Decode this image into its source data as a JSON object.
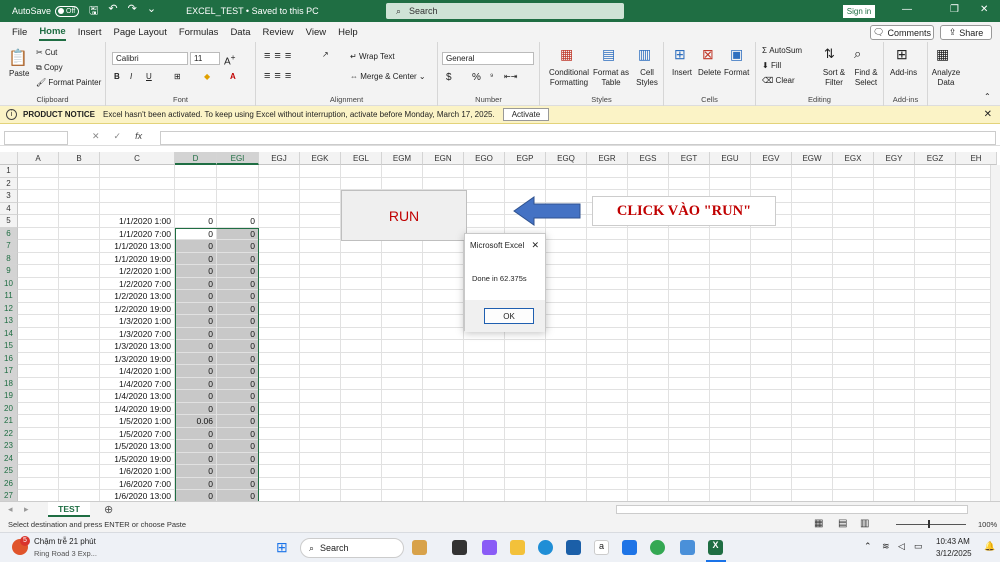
{
  "titlebar": {
    "autosave_label": "AutoSave",
    "autosave_state": "Off",
    "file_title": "EXCEL_TEST • Saved to this PC",
    "search_placeholder": "Search",
    "signin_label": "Sign in"
  },
  "tabs": [
    "File",
    "Home",
    "Insert",
    "Page Layout",
    "Formulas",
    "Data",
    "Review",
    "View",
    "Help"
  ],
  "tab_actions": {
    "comments": "Comments",
    "share": "Share"
  },
  "ribbon": {
    "clipboard": {
      "paste": "Paste",
      "cut": "Cut",
      "copy": "Copy",
      "format_painter": "Format Painter",
      "label": "Clipboard"
    },
    "font": {
      "name": "Calibri",
      "size": "11",
      "bold": "B",
      "italic": "I",
      "underline": "U",
      "label": "Font"
    },
    "alignment": {
      "wrap": "Wrap Text",
      "merge": "Merge & Center",
      "label": "Alignment"
    },
    "number": {
      "format": "General",
      "currency": "$",
      "percent": "%",
      "label": "Number"
    },
    "styles": {
      "conditional": "Conditional Formatting",
      "format_table": "Format as Table",
      "cell_styles": "Cell Styles",
      "label": "Styles"
    },
    "cells": {
      "insert": "Insert",
      "delete": "Delete",
      "format": "Format",
      "label": "Cells"
    },
    "editing": {
      "autosum": "AutoSum",
      "fill": "Fill",
      "clear": "Clear",
      "sort": "Sort & Filter",
      "find": "Find & Select",
      "label": "Editing"
    },
    "addins": {
      "addins": "Add-ins",
      "label": "Add-ins"
    },
    "analyze": {
      "label": "Analyze Data"
    }
  },
  "notice": {
    "title": "PRODUCT NOTICE",
    "message": "Excel hasn't been activated. To keep using Excel without interruption, activate before Monday, March 17, 2025.",
    "button": "Activate"
  },
  "formula_bar": {
    "fx": "fx"
  },
  "columns": [
    "A",
    "B",
    "C",
    "D",
    "EGI",
    "EGJ",
    "EGK",
    "EGL",
    "EGM",
    "EGN",
    "EGO",
    "EGP",
    "EGQ",
    "EGR",
    "EGS",
    "EGT",
    "EGU",
    "EGV",
    "EGW",
    "EGX",
    "EGY",
    "EGZ",
    "EH"
  ],
  "rows": [
    {
      "n": "1",
      "c": "",
      "d": "",
      "e": ""
    },
    {
      "n": "2",
      "c": "",
      "d": "",
      "e": ""
    },
    {
      "n": "3",
      "c": "",
      "d": "",
      "e": ""
    },
    {
      "n": "4",
      "c": "",
      "d": "",
      "e": ""
    },
    {
      "n": "5",
      "c": "1/1/2020 1:00",
      "d": "0",
      "e": "0"
    },
    {
      "n": "6",
      "c": "1/1/2020 7:00",
      "d": "0",
      "e": "0"
    },
    {
      "n": "7",
      "c": "1/1/2020 13:00",
      "d": "0",
      "e": "0"
    },
    {
      "n": "8",
      "c": "1/1/2020 19:00",
      "d": "0",
      "e": "0"
    },
    {
      "n": "9",
      "c": "1/2/2020 1:00",
      "d": "0",
      "e": "0"
    },
    {
      "n": "10",
      "c": "1/2/2020 7:00",
      "d": "0",
      "e": "0"
    },
    {
      "n": "11",
      "c": "1/2/2020 13:00",
      "d": "0",
      "e": "0"
    },
    {
      "n": "12",
      "c": "1/2/2020 19:00",
      "d": "0",
      "e": "0"
    },
    {
      "n": "13",
      "c": "1/3/2020 1:00",
      "d": "0",
      "e": "0"
    },
    {
      "n": "14",
      "c": "1/3/2020 7:00",
      "d": "0",
      "e": "0"
    },
    {
      "n": "15",
      "c": "1/3/2020 13:00",
      "d": "0",
      "e": "0"
    },
    {
      "n": "16",
      "c": "1/3/2020 19:00",
      "d": "0",
      "e": "0"
    },
    {
      "n": "17",
      "c": "1/4/2020 1:00",
      "d": "0",
      "e": "0"
    },
    {
      "n": "18",
      "c": "1/4/2020 7:00",
      "d": "0",
      "e": "0"
    },
    {
      "n": "19",
      "c": "1/4/2020 13:00",
      "d": "0",
      "e": "0"
    },
    {
      "n": "20",
      "c": "1/4/2020 19:00",
      "d": "0",
      "e": "0"
    },
    {
      "n": "21",
      "c": "1/5/2020 1:00",
      "d": "0.06",
      "e": "0"
    },
    {
      "n": "22",
      "c": "1/5/2020 7:00",
      "d": "0",
      "e": "0"
    },
    {
      "n": "23",
      "c": "1/5/2020 13:00",
      "d": "0",
      "e": "0"
    },
    {
      "n": "24",
      "c": "1/5/2020 19:00",
      "d": "0",
      "e": "0"
    },
    {
      "n": "25",
      "c": "1/6/2020 1:00",
      "d": "0",
      "e": "0"
    },
    {
      "n": "26",
      "c": "1/6/2020 7:00",
      "d": "0",
      "e": "0"
    },
    {
      "n": "27",
      "c": "1/6/2020 13:00",
      "d": "0",
      "e": "0"
    }
  ],
  "run_button": "RUN",
  "callout": "CLICK VÀO \"RUN\"",
  "dialog": {
    "title": "Microsoft Excel",
    "message": "Done in 62.375s",
    "ok": "OK"
  },
  "sheet": {
    "tab": "TEST"
  },
  "status": {
    "message": "Select destination and press ENTER or choose Paste",
    "zoom": "100%"
  },
  "taskbar": {
    "weather_badge": "5",
    "weather_title": "Chậm trễ 21 phút",
    "weather_sub": "Ring Road 3 Exp...",
    "search": "Search",
    "time": "10:43 AM",
    "date": "3/12/2025"
  },
  "colors": {
    "excel_green": "#1f6e43",
    "run_red": "#c00000",
    "selection_gray": "#c8c8c8"
  }
}
